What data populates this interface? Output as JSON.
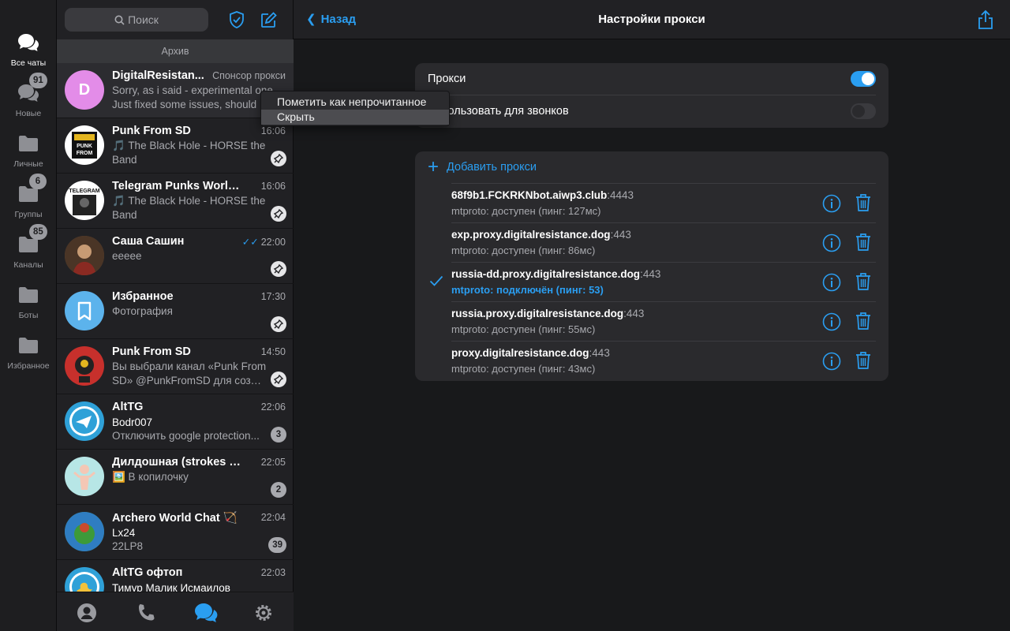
{
  "folders": [
    {
      "label": "Все чаты",
      "badge": "",
      "active": true
    },
    {
      "label": "Новые",
      "badge": "91"
    },
    {
      "label": "Личные",
      "badge": ""
    },
    {
      "label": "Группы",
      "badge": "6"
    },
    {
      "label": "Каналы",
      "badge": "85"
    },
    {
      "label": "Боты",
      "badge": ""
    },
    {
      "label": "Избранное",
      "badge": ""
    }
  ],
  "search": {
    "placeholder": "Поиск"
  },
  "archive_label": "Архив",
  "chats": [
    {
      "name": "DigitalResistan...",
      "time": "Спонсор прокси",
      "line1": "Sorry, as i said - experimental one",
      "line2": "Just fixed some issues, should",
      "avatar_letter": "D"
    },
    {
      "name": "Punk From SD",
      "time": "16:06",
      "line1": "🎵 The Black Hole - HORSE the",
      "line2": "Band"
    },
    {
      "name": "Telegram Punks World...",
      "time": "16:06",
      "line1": "🎵 The Black Hole - HORSE the",
      "line2": "Band"
    },
    {
      "name": "Саша Сашин",
      "time": "22:00",
      "line1": "eeeee",
      "line2": ""
    },
    {
      "name": "Избранное",
      "time": "17:30",
      "line1": "Фотография",
      "line2": ""
    },
    {
      "name": "Punk From SD",
      "time": "14:50",
      "line1": "Вы выбрали канал «Punk From",
      "line2": "SD» @PunkFromSD для созд..."
    },
    {
      "name": "AltTG",
      "time": "22:06",
      "sender": "Bodr007",
      "line2": "Отключить google protection...",
      "badge": "3"
    },
    {
      "name": "Дилдошная (strokes b...",
      "time": "22:05",
      "line1": "🖼️ В копилочку",
      "line2": "",
      "badge": "2"
    },
    {
      "name": "Archero World Chat 🏹",
      "time": "22:04",
      "sender": "Lx24",
      "line2": "22LP8",
      "badge": "39"
    },
    {
      "name": "AltTG офтоп",
      "time": "22:03",
      "sender": "Тимур Малик Исмаилов",
      "line2": ""
    }
  ],
  "context_menu": {
    "items": [
      "Пометить как непрочитанное",
      "Скрыть"
    ]
  },
  "header": {
    "back": "Назад",
    "title": "Настройки прокси"
  },
  "settings": {
    "proxy_label": "Прокси",
    "proxy_enabled": true,
    "calls_label": "Использовать для звонков",
    "calls_enabled": false
  },
  "proxies": {
    "add_label": "Добавить прокси",
    "items": [
      {
        "host": "68f9b1.FCKRKNbot.aiwp3.club",
        "port": ":4443",
        "status": "mtproto: доступен (пинг: 127мс)",
        "active": false
      },
      {
        "host": "exp.proxy.digitalresistance.dog",
        "port": ":443",
        "status": "mtproto: доступен (пинг: 86мс)",
        "active": false
      },
      {
        "host": "russia-dd.proxy.digitalresistance.dog",
        "port": ":443",
        "status": "mtproto: подключён (пинг: 53)",
        "active": true
      },
      {
        "host": "russia.proxy.digitalresistance.dog",
        "port": ":443",
        "status": "mtproto: доступен (пинг: 55мс)",
        "active": false
      },
      {
        "host": "proxy.digitalresistance.dog",
        "port": ":443",
        "status": "mtproto: доступен (пинг: 43мс)",
        "active": false
      }
    ]
  },
  "colors": {
    "accent": "#2a9ef1",
    "background": "#18191b",
    "panel": "#212124",
    "card": "#2a2a2d"
  }
}
